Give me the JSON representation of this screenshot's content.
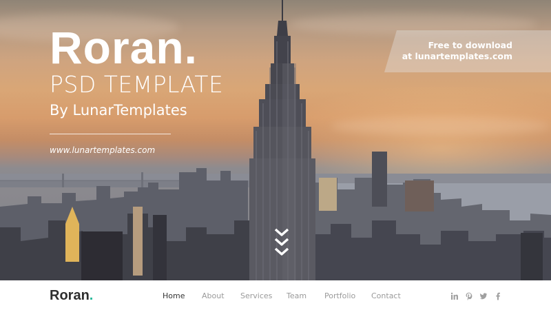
{
  "hero": {
    "title": "Roran.",
    "subtitle": "PSD TEMPLATE",
    "byline": "By LunarTemplates",
    "url": "www.lunartemplates.com"
  },
  "banner": {
    "line1": "Free to download",
    "line2": "at lunartemplates.com"
  },
  "scroll_icon": "double-chevron-down-icon",
  "navbar": {
    "logo": "Roran",
    "logo_dot": ".",
    "accent_color": "#26b899",
    "items": [
      {
        "label": "Home",
        "active": true
      },
      {
        "label": "About",
        "active": false
      },
      {
        "label": "Services",
        "active": false
      },
      {
        "label": "Team",
        "active": false
      },
      {
        "label": "Portfolio",
        "active": false
      },
      {
        "label": "Contact",
        "active": false
      }
    ],
    "social": [
      "linkedin-icon",
      "pinterest-icon",
      "twitter-icon",
      "facebook-icon"
    ]
  }
}
